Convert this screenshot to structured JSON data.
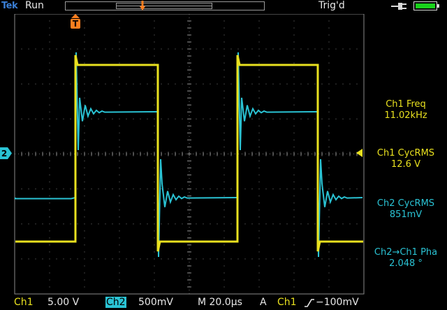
{
  "status": {
    "brand": "Tek",
    "acq_state": "Run",
    "trigger_state": "Trig'd",
    "trigger_marker_label": "T"
  },
  "markers": {
    "ch2_ground_label": "2"
  },
  "measurements": [
    {
      "label": "Ch1 Freq",
      "value": "11.02kHz",
      "color": "#e9e11f"
    },
    {
      "label": "Ch1 CycRMS",
      "value": "12.6 V",
      "color": "#e9e11f"
    },
    {
      "label": "Ch2 CycRMS",
      "value": "851mV",
      "color": "#2ac3d4"
    },
    {
      "label": "Ch2→Ch1 Pha",
      "value": "2.048 °",
      "color": "#2ac3d4"
    }
  ],
  "settings": {
    "ch1_label": "Ch1",
    "ch1_scale": "5.00 V",
    "ch2_label": "Ch2",
    "ch2_scale": "500mV",
    "timebase": "M 20.0µs",
    "trigger_mode": "A",
    "trigger_source": "Ch1",
    "trigger_slope_icon": "rising-edge-icon",
    "trigger_level": "−100mV"
  },
  "colors": {
    "ch1": "#e9e11f",
    "ch2": "#2ac3d4",
    "trigger": "#ff7f1f",
    "battery": "#19d21b",
    "brand": "#3a7fd6"
  },
  "icons": {
    "power": "power-plug-icon",
    "battery": "battery-full-icon"
  }
}
